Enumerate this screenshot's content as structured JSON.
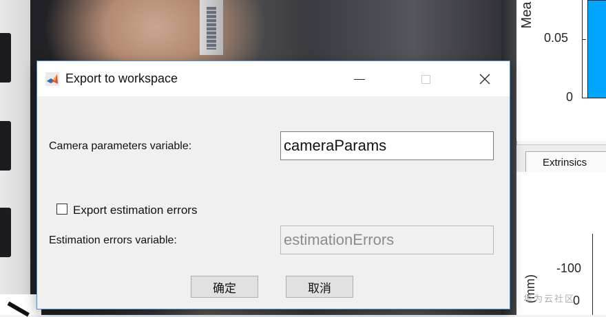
{
  "dialog": {
    "title": "Export to workspace",
    "app_icon": "matlab-logo-icon",
    "window_buttons": {
      "minimize": "minimize-icon",
      "maximize": "maximize-icon",
      "close_icon": "close-icon",
      "close": "✕"
    },
    "camera_params_label": "Camera parameters variable:",
    "camera_params_value": "cameraParams",
    "export_errors_label": "Export estimation errors",
    "export_errors_checked": false,
    "errors_variable_label": "Estimation errors variable:",
    "errors_variable_value": "estimationErrors",
    "ok_button": "确定",
    "cancel_button": "取消"
  },
  "background_figure": {
    "bar_chart": {
      "ylabel_fragment": "Mea",
      "y_ticks": [
        "0.05",
        "0"
      ]
    },
    "tab_label": "Extrinsics",
    "extrinsics_plot": {
      "ylabel_fragment": "(mm)",
      "y_ticks": [
        "-100",
        "0"
      ]
    }
  },
  "watermark": "华为云社区",
  "colors": {
    "bar_fill": "#00a6ff",
    "dialog_border": "#4a90d9",
    "dialog_bg": "#f0f0f0"
  }
}
